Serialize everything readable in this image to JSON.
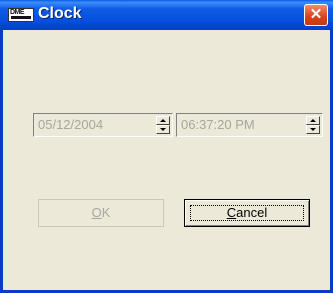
{
  "window": {
    "title": "Clock",
    "icon": "dme-app-icon",
    "icon_text": "DME",
    "close_icon": "close-icon"
  },
  "date_field": {
    "value": "05/12/2004",
    "enabled": false
  },
  "time_field": {
    "value": "06:37:20 PM",
    "enabled": false
  },
  "buttons": {
    "ok_label": "OK",
    "ok_enabled": false,
    "cancel_label": "Cancel"
  },
  "colors": {
    "titlebar": "#0550DC",
    "dialog_bg": "#ECE9D8",
    "close_button": "#D8431A",
    "disabled_text": "#A7A69F"
  }
}
